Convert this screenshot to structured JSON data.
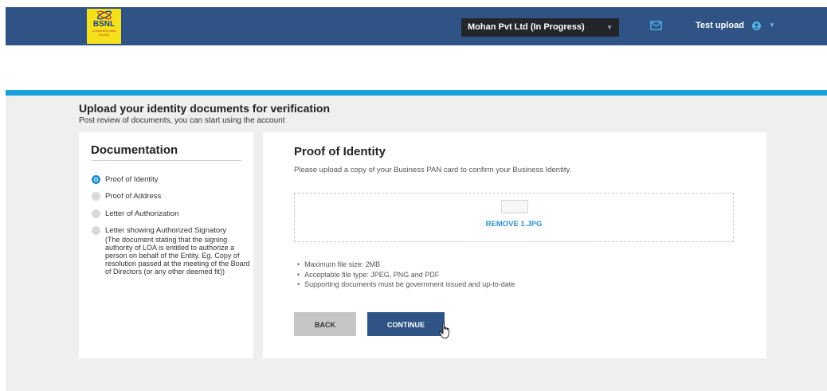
{
  "colors": {
    "header_bg": "#2f5384",
    "accent": "#1aa0dc",
    "logo_bg": "#f5e11b",
    "primary_button": "#2f5384",
    "secondary_button": "#c6c6c6",
    "link": "#2f8fcf",
    "active_radio": "#1d8fd3"
  },
  "header": {
    "logo": {
      "brand": "BSNL",
      "tagline": "Connecting India Forever",
      "icon": "bsnl-logo"
    },
    "company_selector": {
      "value": "Mohan Pvt Ltd (In Progress)",
      "icon": "chevron-down-icon"
    },
    "mail_icon": "mail-icon",
    "user_name": "Test upload",
    "user_icon": "user-circle-icon",
    "user_caret_icon": "chevron-down-icon"
  },
  "page": {
    "title": "Upload your identity documents for verification",
    "subtitle": "Post review of documents, you can start using the account"
  },
  "sidebar": {
    "title": "Documentation",
    "items": [
      {
        "label": "Proof of Identity",
        "active": true
      },
      {
        "label": "Proof of Address",
        "active": false
      },
      {
        "label": "Letter of Authorization",
        "active": false
      },
      {
        "label": "Letter showing Authorized Signatory",
        "active": false,
        "note": "(The document stating that the signing authority of LOA is entitled to authorize a person on behalf of the Entity. Eg. Copy of resolution passed at the meeting of the Board of Directors (or any other deemed fit))"
      }
    ]
  },
  "main": {
    "title": "Proof of Identity",
    "description": "Please upload a copy of your Business PAN card to confirm your Business Identity.",
    "upload": {
      "remove_label": "REMOVE 1.JPG"
    },
    "rules": [
      "Maximum file size: 2MB",
      "Acceptable file type: JPEG, PNG and PDF",
      "Supporting documents must be government issued and up-to-date"
    ],
    "back_label": "BACK",
    "continue_label": "CONTINUE"
  }
}
